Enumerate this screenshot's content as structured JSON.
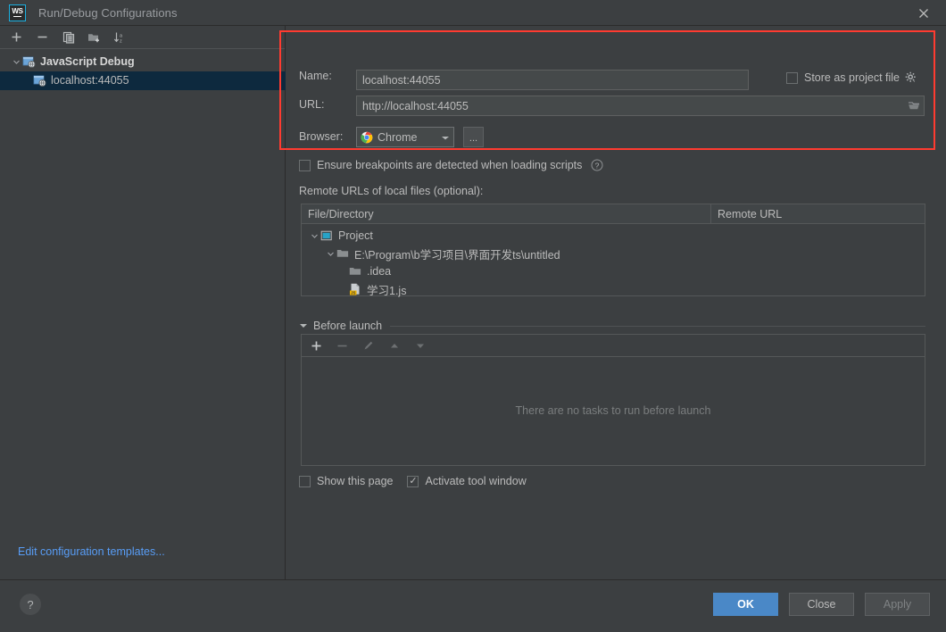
{
  "window": {
    "title": "Run/Debug Configurations",
    "logo_text": "WS",
    "close_icon": "close-icon"
  },
  "left_panel": {
    "toolbar": [
      {
        "name": "add-configuration",
        "icon": "plus-icon"
      },
      {
        "name": "remove-configuration",
        "icon": "minus-icon"
      },
      {
        "name": "copy-configuration",
        "icon": "copy-icon"
      },
      {
        "name": "new-folder",
        "icon": "folder-add-icon"
      },
      {
        "name": "sort-configurations",
        "icon": "sort-az-icon"
      }
    ],
    "tree": [
      {
        "label": "JavaScript Debug",
        "icon": "js-debug-icon",
        "group": true,
        "expanded": true,
        "selected": false
      },
      {
        "label": "localhost:44055",
        "icon": "js-debug-icon",
        "group": false,
        "selected": true
      }
    ],
    "edit_templates_link": "Edit configuration templates..."
  },
  "form": {
    "name_label": "Name:",
    "name_value": "localhost:44055",
    "store_as_project_file_label": "Store as project file",
    "store_as_project_file_checked": false,
    "gear_icon": "gear-icon",
    "url_label": "URL:",
    "url_value": "http://localhost:44055",
    "url_browse_icon": "folder-icon",
    "browser_label": "Browser:",
    "browser_value": "Chrome",
    "browser_icon": "chrome-icon",
    "browser_more_label": "...",
    "ensure_breakpoints_label": "Ensure breakpoints are detected when loading scripts",
    "ensure_breakpoints_checked": false,
    "help_icon": "question-circle-icon",
    "remote_urls_label": "Remote URLs of local files (optional):"
  },
  "remote_table": {
    "columns": [
      "File/Directory",
      "Remote URL"
    ],
    "rows": [
      {
        "label": "Project",
        "icon": "project-icon",
        "depth": 0,
        "expanded": true,
        "remote_url": ""
      },
      {
        "label": "E:\\Program\\b学习项目\\界面开发ts\\untitled",
        "icon": "folder-icon",
        "depth": 1,
        "expanded": true,
        "remote_url": ""
      },
      {
        "label": ".idea",
        "icon": "folder-icon",
        "depth": 2,
        "expanded": null,
        "remote_url": ""
      },
      {
        "label": "学习1.js",
        "icon": "js-file-icon",
        "depth": 2,
        "expanded": null,
        "remote_url": ""
      }
    ]
  },
  "before_launch": {
    "title": "Before launch",
    "expanded": true,
    "toolbar": [
      {
        "name": "add-task",
        "icon": "plus-icon",
        "enabled": true
      },
      {
        "name": "remove-task",
        "icon": "minus-icon",
        "enabled": false
      },
      {
        "name": "edit-task",
        "icon": "pencil-icon",
        "enabled": false
      },
      {
        "name": "move-task-up",
        "icon": "arrow-up-icon",
        "enabled": false
      },
      {
        "name": "move-task-down",
        "icon": "arrow-down-icon",
        "enabled": false
      }
    ],
    "empty_message": "There are no tasks to run before launch",
    "show_this_page_label": "Show this page",
    "show_this_page_checked": false,
    "activate_tool_window_label": "Activate tool window",
    "activate_tool_window_checked": true
  },
  "footer": {
    "help_label": "?",
    "ok_label": "OK",
    "close_label": "Close",
    "apply_label": "Apply"
  },
  "annotation": {
    "highlight_color": "#ff3b30"
  }
}
